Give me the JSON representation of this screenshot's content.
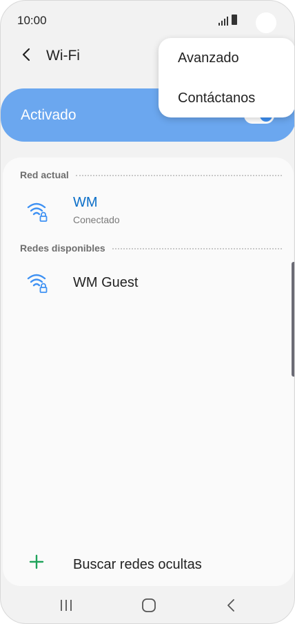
{
  "status_bar": {
    "time": "10:00"
  },
  "toolbar": {
    "title": "Wi-Fi"
  },
  "master_switch": {
    "label": "Activado",
    "state": "on"
  },
  "sections": {
    "current": {
      "label": "Red actual"
    },
    "available": {
      "label": "Redes disponibles"
    }
  },
  "networks": {
    "current": {
      "name": "WM",
      "status": "Conectado",
      "name_color": "#0a6ec8"
    },
    "available": [
      {
        "name": "WM Guest"
      }
    ]
  },
  "actions": {
    "hidden_networks": "Buscar redes ocultas"
  },
  "menu": {
    "items": [
      "Avanzado",
      "Contáctanos"
    ]
  },
  "colors": {
    "accent": "#3e91f3",
    "toggle_bar": "#6ba7ef",
    "plus": "#1fa35a"
  },
  "icons": {
    "back": "back-arrow-icon",
    "wifi_secured": "wifi-lock-icon",
    "add": "plus-icon",
    "nav": [
      "recents-icon",
      "home-icon",
      "back-icon"
    ]
  }
}
